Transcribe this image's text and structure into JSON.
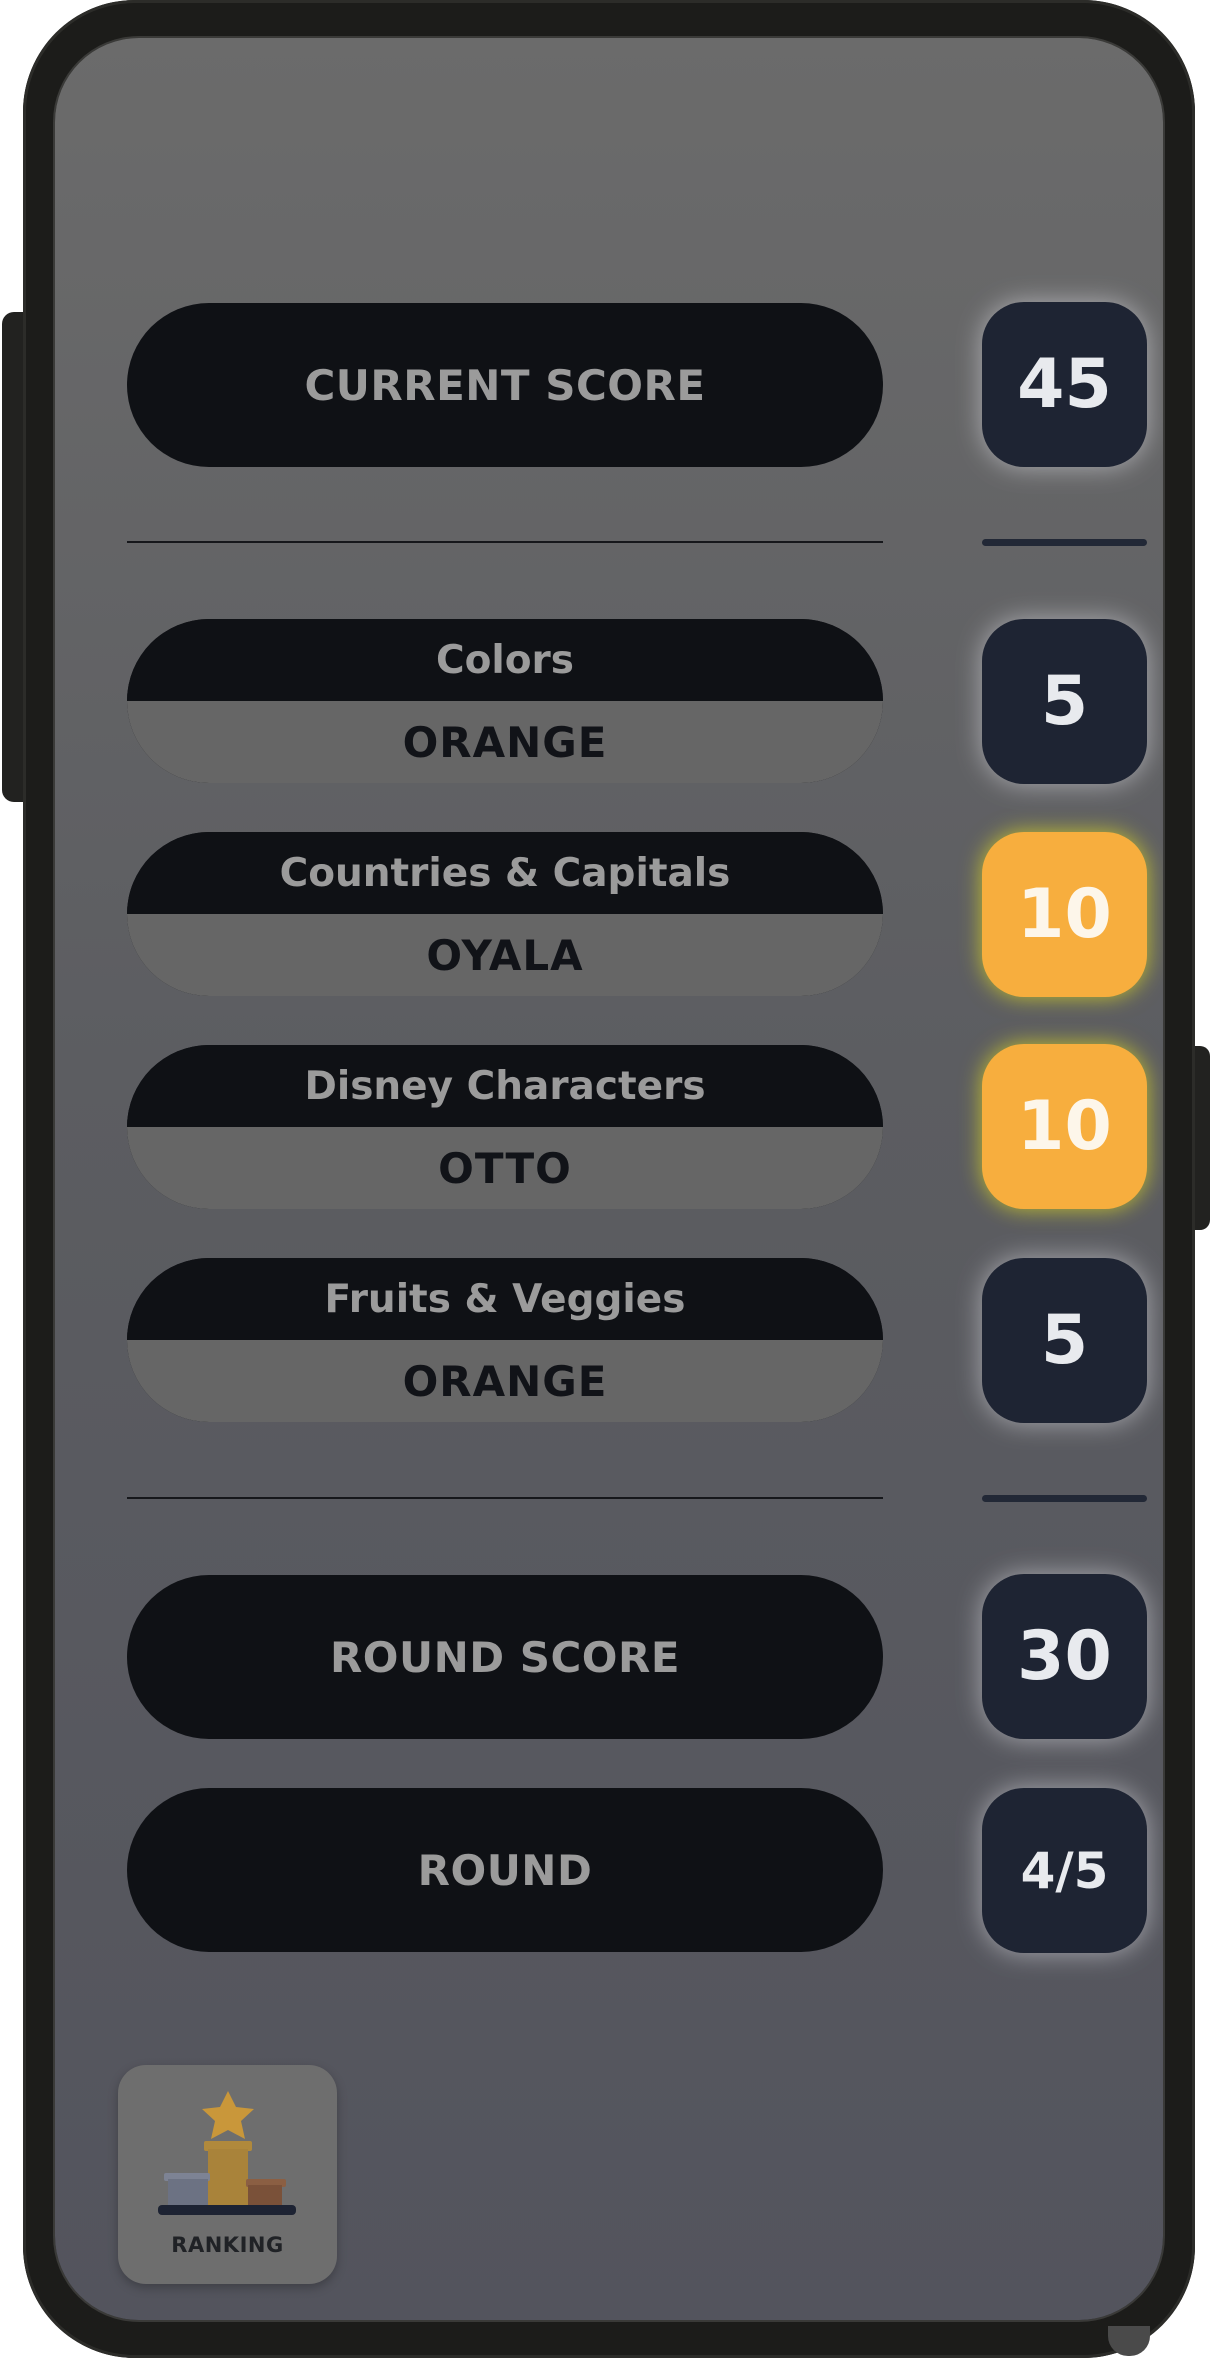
{
  "current_score": {
    "label": "CURRENT SCORE",
    "value": "45"
  },
  "categories": [
    {
      "name": "Colors",
      "answer": "ORANGE",
      "points": "5",
      "highlighted": false
    },
    {
      "name": "Countries & Capitals",
      "answer": "OYALA",
      "points": "10",
      "highlighted": true
    },
    {
      "name": "Disney Characters",
      "answer": "OTTO",
      "points": "10",
      "highlighted": true
    },
    {
      "name": "Fruits & Veggies",
      "answer": "ORANGE",
      "points": "5",
      "highlighted": false
    }
  ],
  "round_score": {
    "label": "ROUND SCORE",
    "value": "30"
  },
  "round": {
    "label": "ROUND",
    "value": "4/5"
  },
  "ranking": {
    "label": "RANKING",
    "icon": "podium-star-icon"
  },
  "colors": {
    "pill_dark": "#0f1115",
    "answer_band": "#666666",
    "badge_dark": "#1e2433",
    "badge_highlight": "#f7ae3e"
  }
}
